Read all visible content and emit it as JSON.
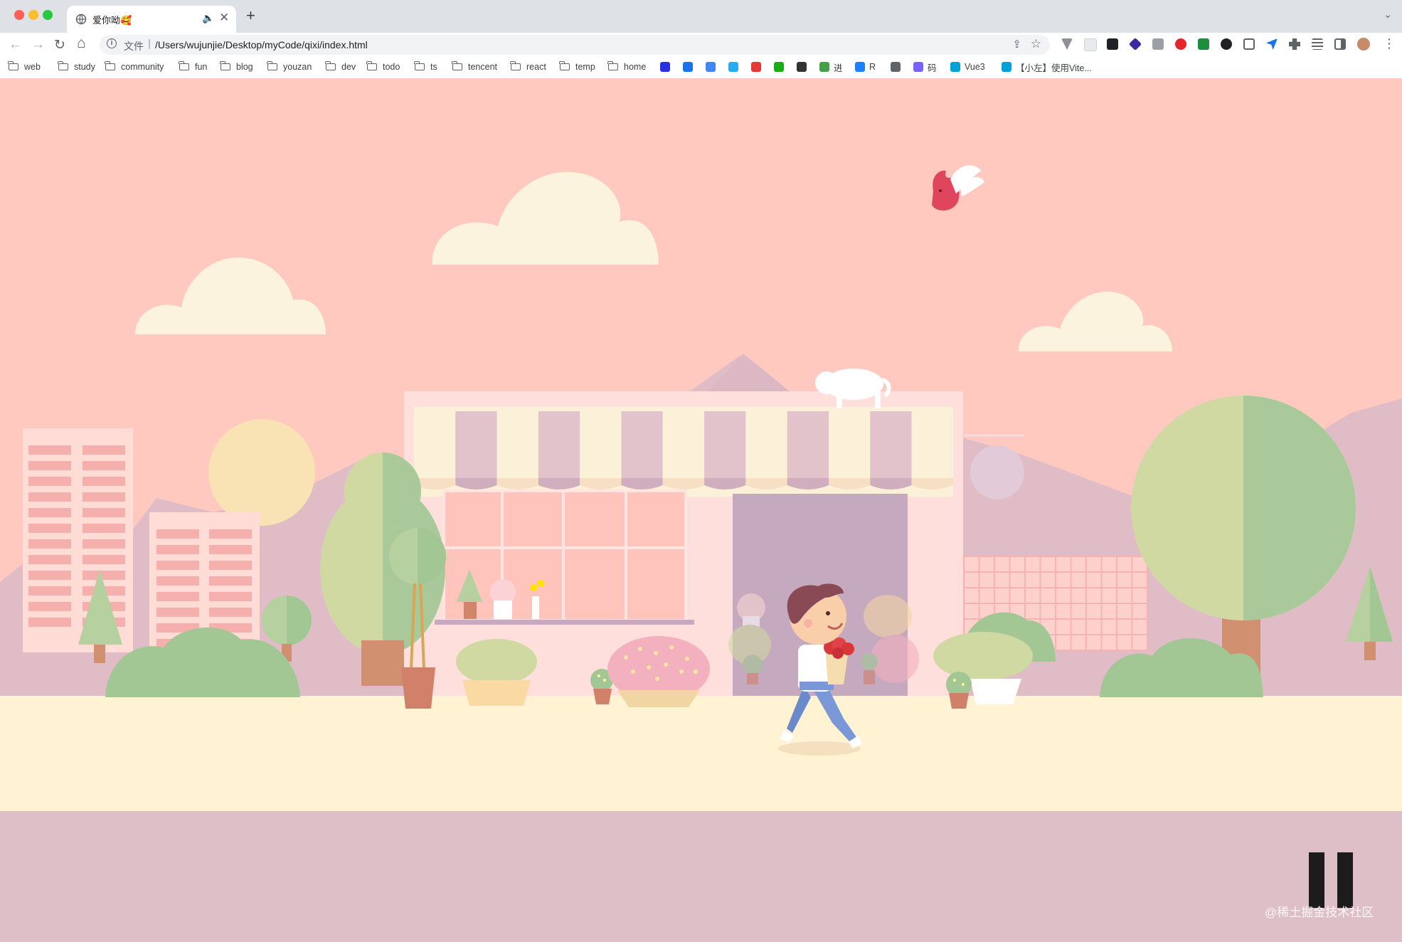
{
  "window": {
    "traffic_colors": [
      "#ff5f57",
      "#febc2e",
      "#28c840"
    ]
  },
  "tab": {
    "title": "爱你呦🥰",
    "favicon": "globe-icon",
    "audio_icon": "🔈",
    "close_icon": "✕"
  },
  "newtab": {
    "label": "+"
  },
  "tabs_menu": {
    "icon": "⌄"
  },
  "toolbar": {
    "back": "←",
    "forward": "→",
    "reload": "↻",
    "home": "⌂",
    "scheme_label": "文件",
    "separator": "|",
    "url": "/Users/wujunjie/Desktop/myCode/qixi/index.html",
    "share_icon": "⇪",
    "star_icon": "☆",
    "menu_icon": "⋮"
  },
  "bookmarks": {
    "folders": [
      "web",
      "study",
      "community",
      "fun",
      "blog",
      "youzan",
      "dev",
      "todo",
      "ts",
      "tencent",
      "react",
      "temp",
      "home"
    ],
    "sites": [
      {
        "label": "",
        "icon": "baidu-icon",
        "color": "#2932e1"
      },
      {
        "label": "",
        "icon": "translate-icon",
        "color": "#1a73e8"
      },
      {
        "label": "",
        "icon": "google-icon",
        "color": "#4285f4"
      },
      {
        "label": "",
        "icon": "telegram-icon",
        "color": "#2aabee"
      },
      {
        "label": "",
        "icon": "red-book-icon",
        "color": "#e53935"
      },
      {
        "label": "",
        "icon": "sync-icon",
        "color": "#1aad19"
      },
      {
        "label": "",
        "icon": "avatar-icon",
        "color": "#333333"
      },
      {
        "label": "进",
        "icon": "leaf-icon",
        "color": "#43a047"
      },
      {
        "label": "R",
        "icon": "juejin-icon",
        "color": "#1e80ff"
      },
      {
        "label": "",
        "icon": "globe-icon",
        "color": "#5f6368"
      },
      {
        "label": "码",
        "icon": "mail-icon",
        "color": "#7b61ff"
      },
      {
        "label": "Vue3",
        "icon": "bilibili-icon",
        "color": "#00a1d6"
      },
      {
        "label": "【小左】使用Vite...",
        "icon": "bilibili-icon",
        "color": "#00a1d6"
      }
    ]
  },
  "scene": {
    "pause_label": "pause",
    "watermark": "@稀土掘金技术社区"
  }
}
